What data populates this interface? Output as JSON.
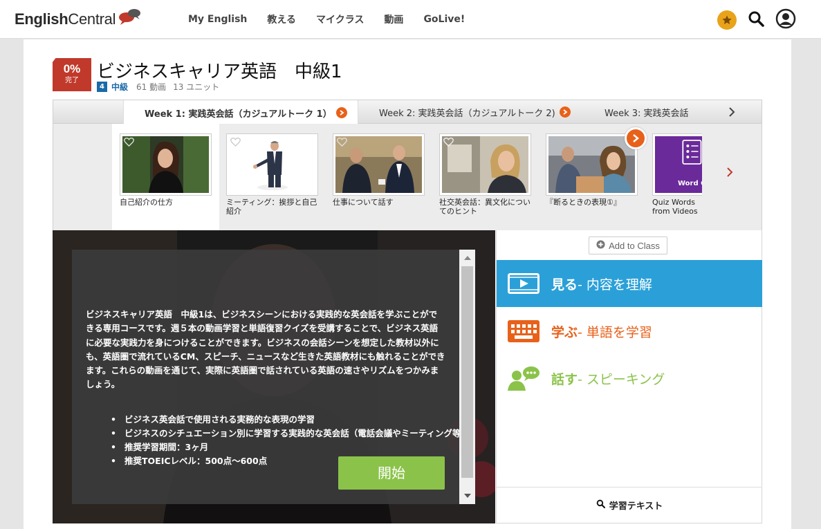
{
  "brand": {
    "logo_prefix": "English",
    "logo_suffix": "Central"
  },
  "nav": [
    "My English",
    "教える",
    "マイクラス",
    "動画",
    "GoLive!"
  ],
  "course": {
    "progress_percent": "0%",
    "progress_label": "完了",
    "title": "ビジネスキャリア英語　中級1",
    "level_number": "4",
    "level_name": "中級",
    "video_count": "61 動画",
    "unit_count": "13 ユニット"
  },
  "weeks": [
    {
      "label": "Week 1: 実践英会話（カジュアルトーク 1）"
    },
    {
      "label": "Week 2: 実践英会話（カジュアルトーク 2)"
    },
    {
      "label": "Week 3: 実践英会話"
    }
  ],
  "videos": [
    {
      "title": "自己紹介の仕方"
    },
    {
      "title": "ミーティング：挨拶と自己紹介"
    },
    {
      "title": "仕事について話す"
    },
    {
      "title": "社交英会話：異文化についてのヒント"
    },
    {
      "title": "『断るときの表現①』"
    },
    {
      "title": "Quiz Words from Videos",
      "thumb_text": "Word Q"
    }
  ],
  "description": {
    "paragraph": "ビジネスキャリア英語　中級1は、ビジネスシーンにおける実践的な英会話を学ぶことができる専用コースです。週５本の動画学習と単語復習クイズを受講することで、ビジネス英語に必要な実践力を身につけることができます。ビジネスの会話シーンを想定した教材以外にも、英語圏で流れているCM、スピーチ、ニュースなど生きた英語教材にも触れることができます。これらの動画を通じて、実際に英語圏で話されている英語の速さやリズムをつかみましょう。",
    "bullets": [
      "ビジネス英会話で使用される実務的な表現の学習",
      "ビジネスのシチュエーション別に学習する実践的な英会話（電話会議やミーティング等)",
      "推奨学習期間：3ヶ月",
      "推奨TOEICレベル：500点～600点"
    ],
    "start_label": "開始"
  },
  "actions": {
    "add_to_class": "Add to Class",
    "watch_main": "見る",
    "watch_sub": " - 内容を理解",
    "learn_main": "学ぶ",
    "learn_sub": " - 単語を学習",
    "speak_main": "話す",
    "speak_sub": " - スピーキング",
    "study_text": "学習テキスト"
  },
  "colors": {
    "accent_orange": "#e8611a",
    "watch_blue": "#2ba0d8",
    "speak_green": "#8bc34a",
    "level_blue": "#1a6aa8",
    "badge_red": "#c0392b"
  },
  "icons": [
    "speech-bubbles-icon",
    "star-icon",
    "search-icon",
    "user-icon",
    "heart-icon",
    "chevron-right-icon",
    "video-icon",
    "keyboard-icon",
    "speaking-person-icon",
    "plus-circle-icon"
  ]
}
